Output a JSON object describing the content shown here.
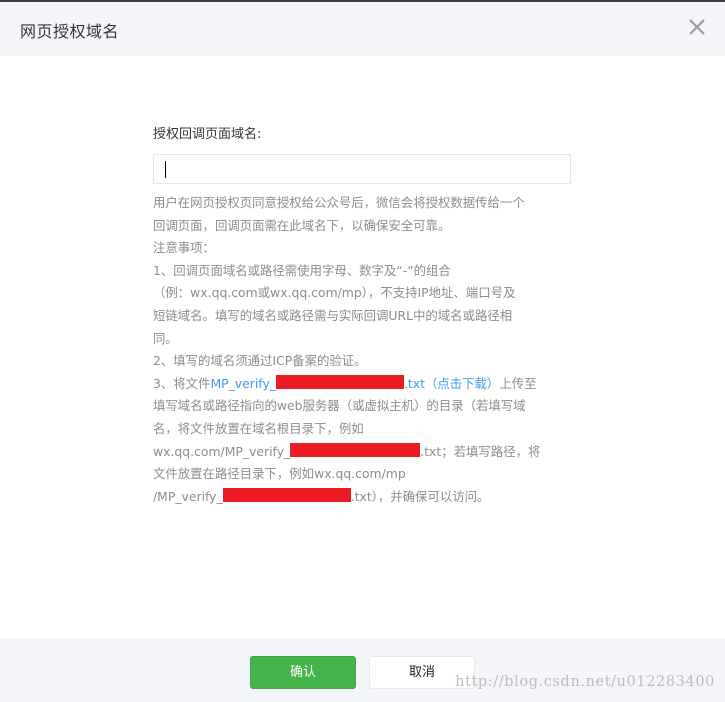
{
  "dialog": {
    "title": "网页授权域名",
    "close_icon": "close-icon"
  },
  "form": {
    "label": "授权回调页面域名:",
    "input_value": "",
    "input_placeholder": ""
  },
  "description": {
    "line1": "用户在网页授权页同意授权给公众号后，微信会将授权数据传给一个",
    "line2": "回调页面，回调页面需在此域名下，以确保安全可靠。",
    "notice_title": "注意事项：",
    "item1_line1": "1、回调页面域名或路径需使用字母、数字及“-”的组合",
    "item1_line2": "（例：wx.qq.com或wx.qq.com/mp），不支持IP地址、端口号及",
    "item1_line3": "短链域名。填写的域名或路径需与实际回调URL中的域名或路径相",
    "item1_line4": "同。",
    "item2": "2、填写的域名须通过ICP备案的验证。",
    "item3_prefix": "3、将文件",
    "item3_link_file_prefix": "MP_verify_",
    "item3_link_file_suffix": ".txt",
    "item3_download_link": "（点击下载）",
    "item3_suffix": "上传至",
    "item3_line2": "填写域名或路径指向的web服务器（或虚拟主机）的目录（若填写域",
    "item3_line3": "名，将文件放置在域名根目录下，例如",
    "item3_line4_prefix": "wx.qq.com/MP_verify_",
    "item3_line4_suffix": ".txt；若填写路径，将",
    "item3_line5": "文件放置在路径目录下，例如wx.qq.com/mp",
    "item3_line6_prefix": "/MP_verify_",
    "item3_line6_suffix": ".txt），并确保可以访问。"
  },
  "footer": {
    "ok_label": "确认",
    "cancel_label": "取消"
  },
  "watermark": "http://blog.csdn.net/u012283400",
  "colors": {
    "accent_green": "#44b549",
    "link_blue": "#459ae9",
    "redaction_red": "#ed1c24",
    "header_bg": "#f4f5f9"
  }
}
